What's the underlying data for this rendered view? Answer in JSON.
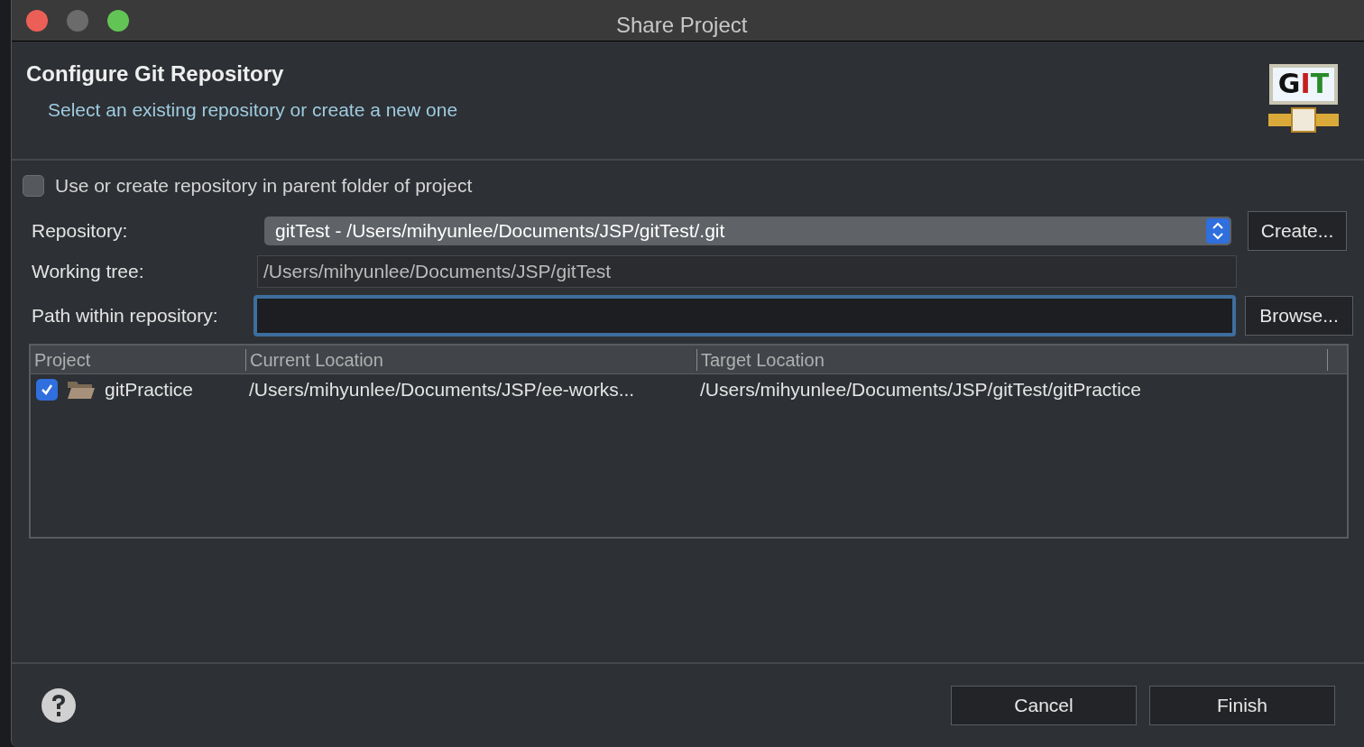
{
  "window": {
    "title": "Share Project"
  },
  "header": {
    "title": "Configure Git Repository",
    "subtitle": "Select an existing repository or create a new one",
    "logo_text": "GIT"
  },
  "parent_folder_option": {
    "label": "Use or create repository in parent folder of project",
    "checked": false
  },
  "repository": {
    "label": "Repository:",
    "value": "gitTest - /Users/mihyunlee/Documents/JSP/gitTest/.git",
    "button": "Create..."
  },
  "working_tree": {
    "label": "Working tree:",
    "value": "/Users/mihyunlee/Documents/JSP/gitTest"
  },
  "path_within_repository": {
    "label": "Path within repository:",
    "button": "Browse..."
  },
  "table": {
    "columns": [
      "Project",
      "Current Location",
      "Target Location"
    ],
    "rows": [
      {
        "checked": true,
        "project": "gitPractice",
        "current_location": "/Users/mihyunlee/Documents/JSP/ee-works...",
        "target_location": "/Users/mihyunlee/Documents/JSP/gitTest/gitPractice"
      }
    ]
  },
  "buttons": [
    "Cancel",
    "Finish"
  ]
}
